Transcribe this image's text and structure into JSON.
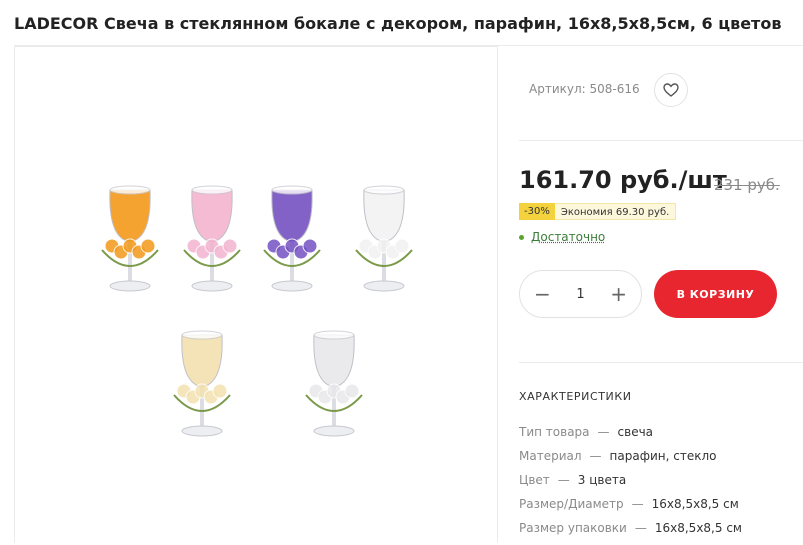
{
  "product": {
    "title": "LADECOR Свеча в стеклянном бокале с декором, парафин, 16x8,5x8,5см, 6 цветов",
    "article": "Артикул: 508-616",
    "price": "161.70 руб./шт",
    "old_price": "231 руб.",
    "discount_pct": "-30%",
    "savings": "Экономия 69.30 руб.",
    "stock": "Достаточно",
    "quantity": "1",
    "cart_button": "В КОРЗИНУ",
    "favorite_icon": "heart-icon"
  },
  "specs": {
    "title": "ХАРАКТЕРИСТИКИ",
    "rows": [
      {
        "key": "Тип товара",
        "value": "свеча"
      },
      {
        "key": "Материал",
        "value": "парафин, стекло"
      },
      {
        "key": "Цвет",
        "value": "3 цвета"
      },
      {
        "key": "Размер/Диаметр",
        "value": "16x8,5x8,5 см"
      },
      {
        "key": "Размер упаковки",
        "value": "16x8,5x8,5 см"
      }
    ]
  },
  "colors": {
    "accent": "#e8262f",
    "discount_badge": "#f3d23d",
    "stock_dot": "#5aa32e",
    "candles": [
      "#f39a1a",
      "#f3b4cf",
      "#7552c2",
      "#f2f2f2",
      "#f3e1b0",
      "#e8e8ec"
    ]
  }
}
